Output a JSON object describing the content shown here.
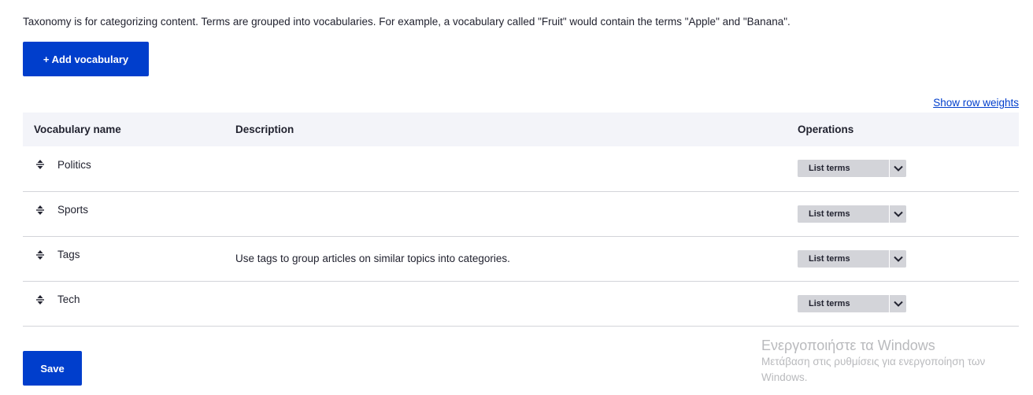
{
  "intro_text": "Taxonomy is for categorizing content. Terms are grouped into vocabularies. For example, a vocabulary called \"Fruit\" would contain the terms \"Apple\" and \"Banana\".",
  "add_vocabulary_label": "+ Add vocabulary",
  "show_row_weights_label": "Show row weights",
  "table": {
    "headers": {
      "name": "Vocabulary name",
      "description": "Description",
      "operations": "Operations"
    },
    "rows": [
      {
        "name": "Politics",
        "description": "",
        "operation": "List terms"
      },
      {
        "name": "Sports",
        "description": "",
        "operation": "List terms"
      },
      {
        "name": "Tags",
        "description": "Use tags to group articles on similar topics into categories.",
        "operation": "List terms"
      },
      {
        "name": "Tech",
        "description": "",
        "operation": "List terms"
      }
    ]
  },
  "save_label": "Save",
  "watermark": {
    "title": "Ενεργοποιήστε τα Windows",
    "line1": "Μετάβαση στις ρυθμίσεις για ενεργοποίηση των",
    "line2": "Windows."
  },
  "colors": {
    "primary": "#003ecc",
    "header_bg": "#f3f4f9",
    "ops_button": "#d3d4d9"
  },
  "icons": {
    "drag": "drag-handle-icon",
    "dropdown": "chevron-down-icon"
  }
}
